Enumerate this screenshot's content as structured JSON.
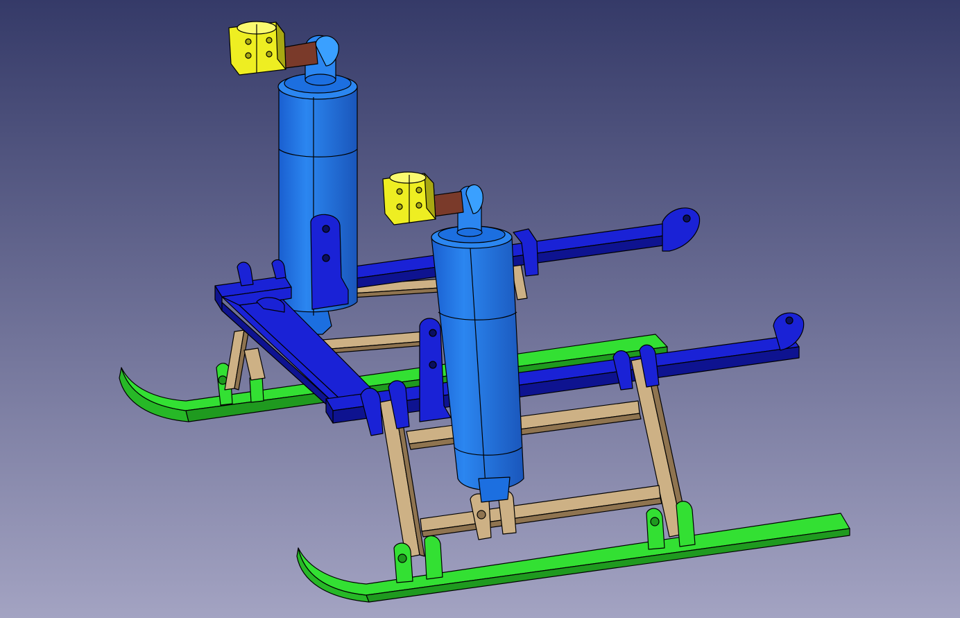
{
  "viewport": {
    "background_top": "#353a68",
    "background_bottom": "#a3a3c2"
  },
  "colors": {
    "skid": "#33e033",
    "skid_dark": "#1f9a1f",
    "frame": "#1a22d6",
    "frame_dark": "#0e1390",
    "cylinder": "#1c6fe0",
    "cylinder_dark": "#1350a8",
    "strut": "#cdb185",
    "strut_dark": "#8f7450",
    "rod": "#7a3a2a",
    "clamp": "#eeee22",
    "clamp_dark": "#a8a812",
    "edge": "#000000"
  },
  "model": {
    "parts": [
      "skid",
      "skid",
      "frame-beam",
      "frame-beam",
      "cross-beam",
      "shock-cylinder",
      "shock-cylinder",
      "strut-ladder",
      "strut-ladder",
      "clamp",
      "clamp",
      "piston-rod",
      "piston-rod"
    ]
  }
}
